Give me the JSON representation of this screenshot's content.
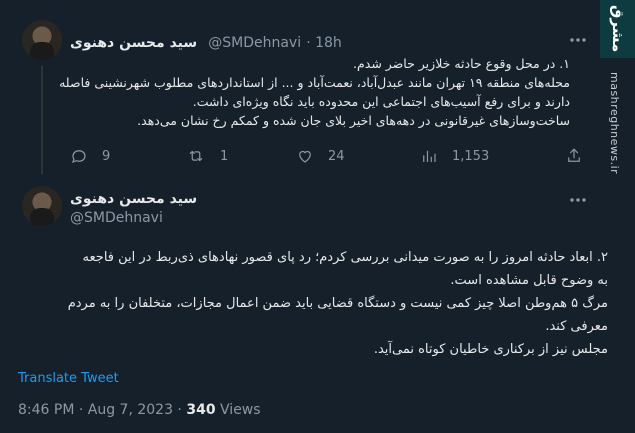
{
  "tweet1": {
    "author_name": "سید محسن دهنوی",
    "handle": "@SMDehnavi",
    "time": "18h",
    "lines": [
      "۱. در محل وقوع حادثه خلازیر حاضر شدم.",
      "محله‌های منطقه ۱۹ تهران مانند عبدل‌آباد، نعمت‌آباد و ... از استانداردهای مطلوب شهرنشینی فاصله",
      "دارند و برای رفع آسیب‌های اجتماعی این محدوده باید نگاه ویژه‌ای داشت.",
      "ساخت‌وسازهای غیرقانونی در دهه‌های اخیر بلای جان شده و کمکم رخ نشان می‌دهد."
    ],
    "replies": "9",
    "retweets": "1",
    "likes": "24",
    "views": "1,153"
  },
  "tweet2": {
    "author_name": "سید محسن دهنوی",
    "handle": "@SMDehnavi",
    "lines": [
      "۲. ابعاد حادثه امروز را به صورت میدانی بررسی کردم؛ رد پای قصور نهادهای ذی‌ربط در این فاجعه",
      "به وضوح قابل مشاهده است.",
      "مرگ ۵ هم‌وطن اصلا چیز کمی نیست و دستگاه قضایی باید ضمن اعمال مجازات، متخلفان را به مردم",
      "معرفی کند.",
      "مجلس نیز از برکناری خاطیان کوتاه نمی‌آید."
    ],
    "translate": "Translate Tweet",
    "timestamp": "8:46 PM · Aug 7, 2023 ·",
    "views_count": "340",
    "views_label": "Views"
  },
  "watermark": {
    "brand": "مشرق",
    "site": "mashreghnews.ir"
  },
  "colors": {
    "background": "#15202b",
    "text": "#e7e9ea",
    "muted": "#8b98a5",
    "link": "#1d9bf0",
    "divider": "#2f3336"
  }
}
